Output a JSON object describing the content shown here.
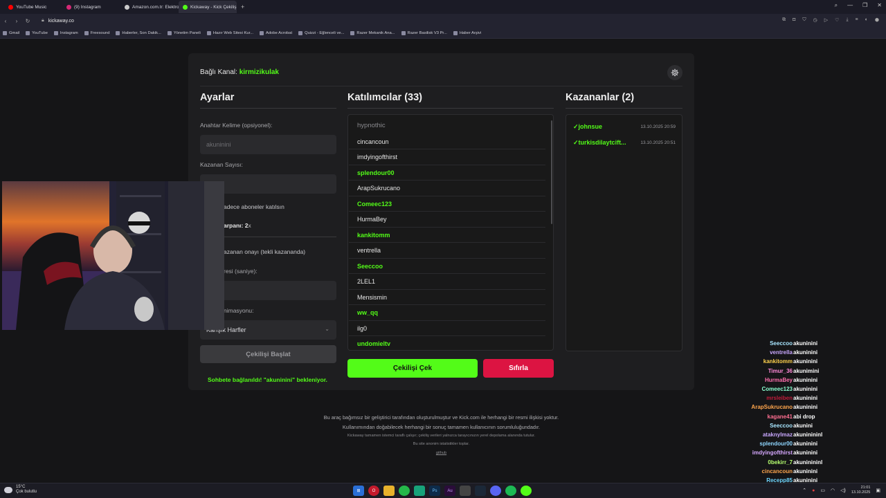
{
  "browser": {
    "tabs": [
      {
        "label": "YouTube Music",
        "color": "#ff0000",
        "active": false
      },
      {
        "label": "(9) Instagram",
        "color": "#d62976",
        "active": false
      },
      {
        "label": "Amazon.com.tr: Elektronik",
        "color": "#cccccc",
        "active": false
      },
      {
        "label": "Kickaway - Kick Çekiliş Aracı",
        "color": "#53fc18",
        "active": true
      }
    ],
    "new_tab": "+",
    "url": "kickaway.co",
    "bookmarks": [
      "Gmail",
      "YouTube",
      "Instagram",
      "Freesound",
      "Haberler, Son Dakik...",
      "Yönetim Paneli",
      "Hazır Web Sitesi Kur...",
      "Adobe Acrobat",
      "Quizzi - Eğlenceli ve...",
      "Razer Mekanik Ana...",
      "Razer Basilisk V3 Pr...",
      "Haber Arşivi"
    ]
  },
  "header": {
    "channel_label": "Bağlı Kanal:",
    "channel_name": "kirmizikulak"
  },
  "settings": {
    "title": "Ayarlar",
    "keyword_label": "Anahtar Kelime (opsiyonel):",
    "keyword_value": "akuninini",
    "winner_count_label": "Kazanan Sayısı:",
    "subs_only_label": "adece aboneler katılsın",
    "multiplier_label": "arpanı: 2",
    "multiplier_suffix": "x",
    "approval_label": "azanan onayı (tekli kazananda)",
    "duration_label": "resi (saniye):",
    "animation_label": "nimasyonu:",
    "animation_value": "Karışık Harfler",
    "start_button": "Çekilişi Başlat",
    "status_text": "Sohbete bağlanıldı! \"akuninini\" bekleniyor."
  },
  "participants": {
    "title": "Katılımcılar (33)",
    "search_placeholder": "hypnothic",
    "items": [
      {
        "name": "cincancoun",
        "green": false
      },
      {
        "name": "imdyingofthirst",
        "green": false
      },
      {
        "name": "splendour00",
        "green": true
      },
      {
        "name": "ArapSukrucano",
        "green": false
      },
      {
        "name": "Comeec123",
        "green": true
      },
      {
        "name": "HurmaBey",
        "green": false
      },
      {
        "name": "kankitomm",
        "green": true
      },
      {
        "name": "ventrella",
        "green": false
      },
      {
        "name": "Seeccoo",
        "green": true
      },
      {
        "name": "2LEL1",
        "green": false
      },
      {
        "name": "Mensismin",
        "green": false
      },
      {
        "name": "ww_qq",
        "green": true
      },
      {
        "name": "ilg0",
        "green": false
      },
      {
        "name": "undomieltv",
        "green": true
      }
    ],
    "draw_button": "Çekilişi Çek",
    "reset_button": "Sıfırla"
  },
  "winners": {
    "title": "Kazananlar (2)",
    "items": [
      {
        "check": "✓",
        "name": "johnsue",
        "time": "13.10.2025 20:59"
      },
      {
        "check": "✓",
        "name": "turkisdilaytcift...",
        "time": "13.10.2025 20:51"
      }
    ]
  },
  "footer": {
    "line1": "Bu araç bağımsız bir geliştirici tarafından oluşturulmuştur ve Kick.com ile herhangi bir resmi ilişkisi yoktur.",
    "line2": "Kullanımından doğabilecek herhangi bir sonuç tamamen kullanıcının sorumluluğundadır.",
    "line3": "Kickaway tamamen istemci taraflı çalışır; çekiliş verileri yalnızca tarayıcınızın yerel depolama alanında tutulur.",
    "line4": "Bu site anonim istatistikler toplar.",
    "line5": "github"
  },
  "chat": [
    {
      "user": "Seeccoo",
      "msg": "akuninini",
      "color": "#a8e6ff"
    },
    {
      "user": "ventrella",
      "msg": "akuninini",
      "color": "#c9a8ff"
    },
    {
      "user": "kankitomm",
      "msg": "akuninini",
      "color": "#ffd24d"
    },
    {
      "user": "Timur_36",
      "msg": "akunimini",
      "color": "#ff8ad8"
    },
    {
      "user": "HurmaBey",
      "msg": "akuninini",
      "color": "#ff6fae"
    },
    {
      "user": "Comeec123",
      "msg": "akuninini",
      "color": "#8affd0"
    },
    {
      "user": "mrsleiben",
      "msg": "akuninini",
      "color": "#c21c3a"
    },
    {
      "user": "ArapSukrucano",
      "msg": "akuninini",
      "color": "#ffa64d"
    },
    {
      "user": "kagane41",
      "msg": "abi drop",
      "color": "#ff6f91"
    },
    {
      "user": "Seeccoo",
      "msg": "akunini",
      "color": "#a8e6ff"
    },
    {
      "user": "ataknylmaz",
      "msg": "akuninininl",
      "color": "#c9a8ff"
    },
    {
      "user": "splendour00",
      "msg": "akuninini",
      "color": "#8fd6ff"
    },
    {
      "user": "imdyingofthirst",
      "msg": "akuninini",
      "color": "#d6a8ff"
    },
    {
      "user": "0bekirr_7",
      "msg": "akuninininl",
      "color": "#b6ff6f"
    },
    {
      "user": "cincancoun",
      "msg": "akuninini",
      "color": "#ffa64d"
    },
    {
      "user": "Recepp85",
      "msg": "akuninini",
      "color": "#6fd6ff"
    }
  ],
  "taskbar": {
    "temp": "15°C",
    "weather": "Çok bulutlu",
    "time": "21:01",
    "date": "13.10.2025"
  },
  "colors": {
    "kick_green": "#53fc18",
    "reset_red": "#dc1442",
    "card_bg": "#1e1e20"
  }
}
